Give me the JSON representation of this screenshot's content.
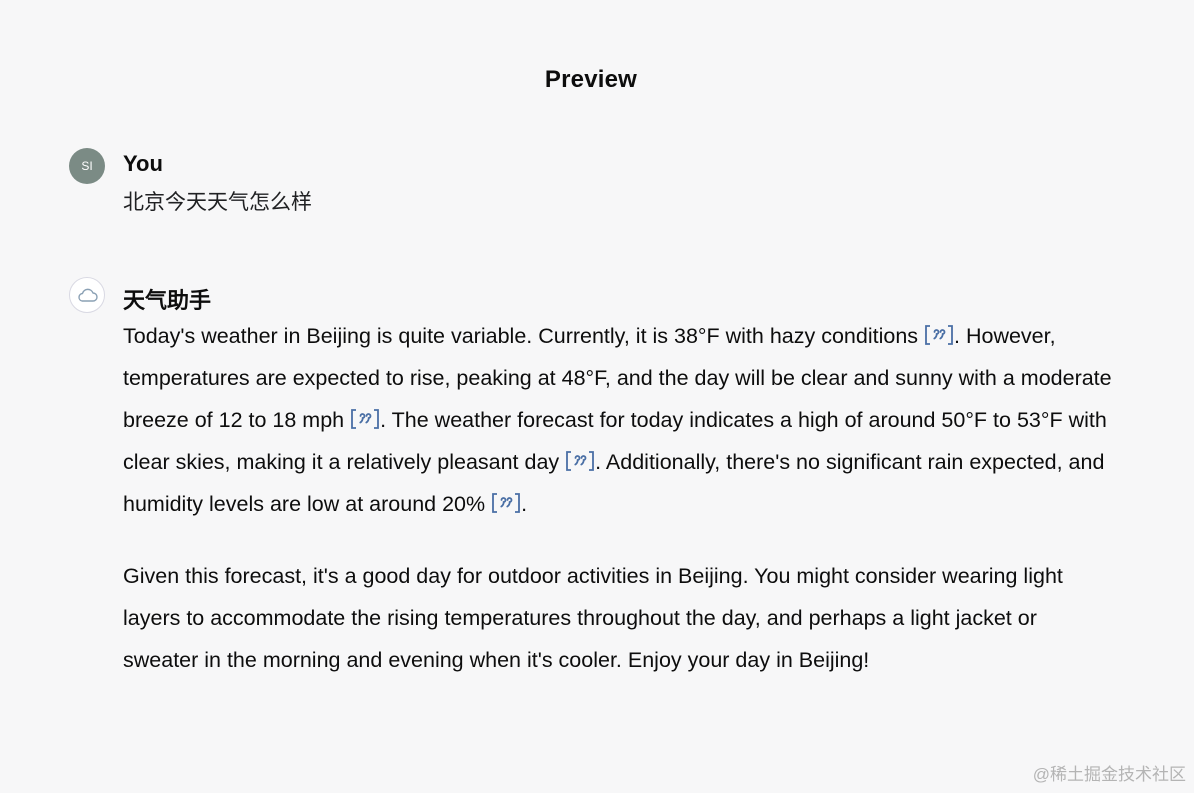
{
  "header": {
    "title": "Preview"
  },
  "user_message": {
    "avatar_initials": "SI",
    "author": "You",
    "text": "北京今天天气怎么样"
  },
  "assistant_message": {
    "avatar_icon": "cloud-icon",
    "author": "天气助手",
    "paragraph1": {
      "seg1": "Today's weather in Beijing is quite variable. Currently, it is 38°F with hazy conditions ",
      "seg2": ". However, temperatures are expected to rise, peaking at 48°F, and the day will be clear and sunny with a moderate breeze of 12 to 18 mph ",
      "seg3": ". The weather forecast for today indicates a high of around 50°F to 53°F with clear skies, making it a relatively pleasant day ",
      "seg4": ". Additionally, there's no significant rain expected, and humidity levels are low at around 20% ",
      "seg5": "."
    },
    "paragraph2": "Given this forecast, it's a good day for outdoor activities in Beijing. You might consider wearing light layers to accommodate the rising temperatures throughout the day, and perhaps a light jacket or sweater in the morning and evening when it's cooler. Enjoy your day in Beijing!",
    "citation_icon": "citation-quote-icon",
    "citation_color": "#4a6fa5"
  },
  "watermark": "@稀土掘金技术社区",
  "colors": {
    "background": "#f7f7f8",
    "user_avatar": "#7b8b85",
    "text": "#0d0d0d"
  }
}
